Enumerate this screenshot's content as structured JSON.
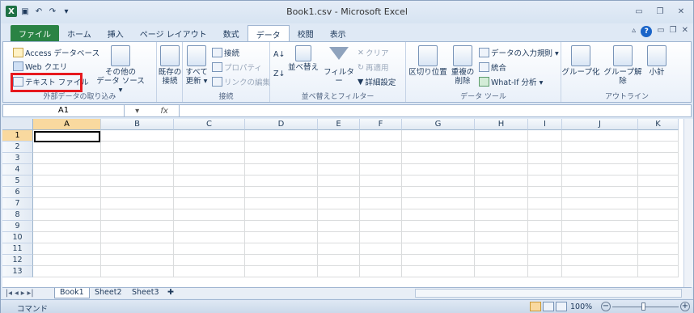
{
  "window": {
    "title": "Book1.csv - Microsoft Excel"
  },
  "tabs": [
    "ファイル",
    "ホーム",
    "挿入",
    "ページ レイアウト",
    "数式",
    "データ",
    "校閲",
    "表示"
  ],
  "ribbon": {
    "ext": {
      "access": "Access データベース",
      "web": "Web クエリ",
      "text_file": "テキスト ファイル",
      "other1": "その他の",
      "other2": "データ ソース ▾",
      "label": "外部データの取り込み"
    },
    "existing": {
      "l1": "既存の",
      "l2": "接続"
    },
    "conn": {
      "refresh1": "すべて",
      "refresh2": "更新 ▾",
      "connections": "接続",
      "properties": "プロパティ",
      "edit_links": "リンクの編集",
      "label": "接続"
    },
    "sort": {
      "sort": "並べ替え",
      "filter": "フィルター",
      "clear": "クリア",
      "reapply": "再適用",
      "advanced": "詳細設定",
      "label": "並べ替えとフィルター"
    },
    "tools": {
      "text_to_col": "区切り位置",
      "dup1": "重複の",
      "dup2": "削除",
      "validation": "データの入力規則 ▾",
      "consolidate": "統合",
      "whatif": "What-If 分析 ▾",
      "label": "データ ツール"
    },
    "outline": {
      "group": "グループ化",
      "ungroup": "グループ解除",
      "subtotal": "小計",
      "label": "アウトライン"
    }
  },
  "formula": {
    "namebox": "A1",
    "fx": "fx"
  },
  "columns": [
    "A",
    "B",
    "C",
    "D",
    "E",
    "F",
    "G",
    "H",
    "I",
    "J",
    "K"
  ],
  "rows": [
    "1",
    "2",
    "3",
    "4",
    "5",
    "6",
    "7",
    "8",
    "9",
    "10",
    "11",
    "12",
    "13"
  ],
  "sheets": {
    "s1": "Book1",
    "s2": "Sheet2",
    "s3": "Sheet3"
  },
  "status": {
    "mode": "コマンド",
    "zoom": "100%"
  }
}
